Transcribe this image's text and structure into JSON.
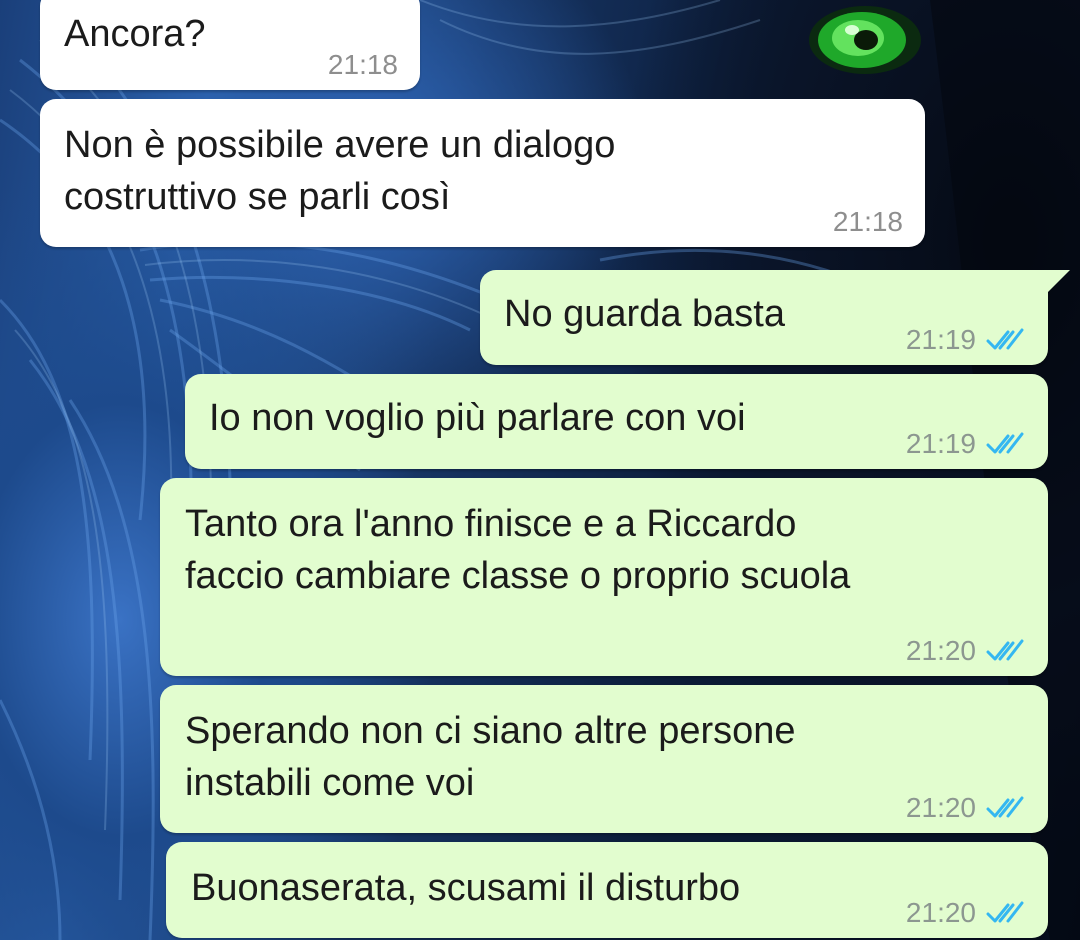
{
  "colors": {
    "incoming_bubble": "#ffffff",
    "outgoing_bubble": "#e2fdcf",
    "read_ticks": "#34b7f1",
    "timestamp": "#8c9790"
  },
  "wallpaper": {
    "description_icon": "wolf-wallpaper"
  },
  "messages": [
    {
      "direction": "incoming",
      "text": "Ancora?",
      "time": "21:18"
    },
    {
      "direction": "incoming",
      "text": "Non è possibile avere un dialogo\ncostruttivo se parli così",
      "time": "21:18"
    },
    {
      "direction": "outgoing",
      "text": "No guarda basta",
      "time": "21:19",
      "status": "read-double-check-icon"
    },
    {
      "direction": "outgoing",
      "text": "Io non voglio più parlare con voi",
      "time": "21:19",
      "status": "read-double-check-icon"
    },
    {
      "direction": "outgoing",
      "text": "Tanto ora l'anno finisce e a Riccardo\nfaccio cambiare classe o proprio scuola",
      "time": "21:20",
      "status": "read-double-check-icon"
    },
    {
      "direction": "outgoing",
      "text": "Sperando non ci siano altre persone\ninstabili come voi",
      "time": "21:20",
      "status": "read-double-check-icon"
    },
    {
      "direction": "outgoing",
      "text": "Buonaserata, scusami il disturbo",
      "time": "21:20",
      "status": "read-double-check-icon"
    }
  ]
}
